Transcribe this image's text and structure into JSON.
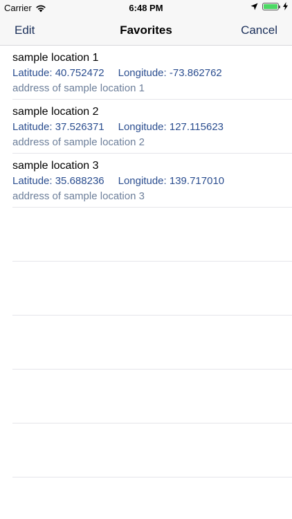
{
  "status_bar": {
    "carrier": "Carrier",
    "time": "6:48 PM",
    "battery_level": 1.0
  },
  "nav": {
    "left_label": "Edit",
    "title": "Favorites",
    "right_label": "Cancel"
  },
  "labels": {
    "latitude": "Latitude:",
    "longitude": "Longitude:"
  },
  "locations": [
    {
      "name": "sample location 1",
      "latitude": "40.752472",
      "longitude": "-73.862762",
      "address": "address of sample location 1"
    },
    {
      "name": "sample location 2",
      "latitude": "37.526371",
      "longitude": "127.115623",
      "address": "address of sample location 2"
    },
    {
      "name": "sample location 3",
      "latitude": "35.688236",
      "longitude": "139.717010",
      "address": "address of sample location 3"
    }
  ],
  "colors": {
    "accent": "#1a2f5a",
    "coords": "#2a4d8f",
    "address": "#6d7f9a",
    "battery": "#4cd964"
  }
}
